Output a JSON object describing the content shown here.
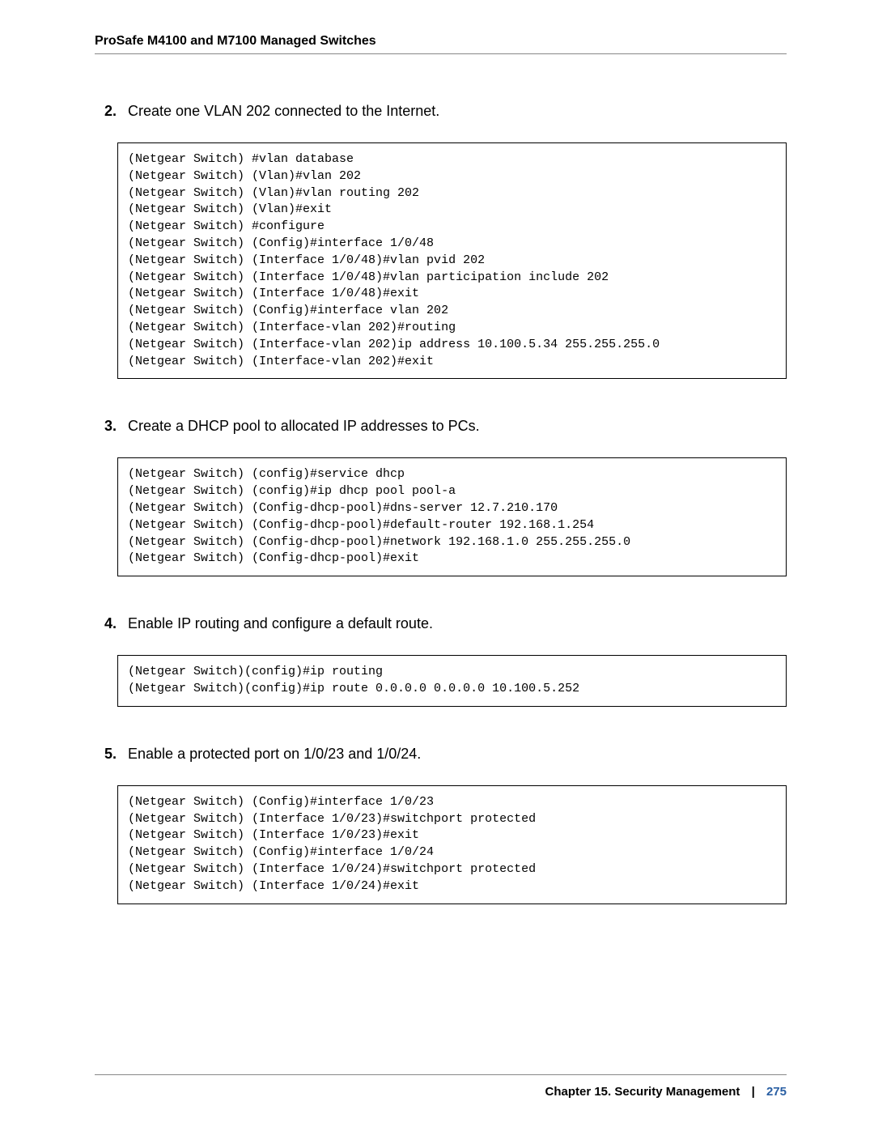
{
  "header": {
    "title": "ProSafe M4100 and M7100 Managed Switches"
  },
  "steps": [
    {
      "num": "2.",
      "text": "Create one VLAN 202 connected to the Internet.",
      "code": "(Netgear Switch) #vlan database\n(Netgear Switch) (Vlan)#vlan 202\n(Netgear Switch) (Vlan)#vlan routing 202\n(Netgear Switch) (Vlan)#exit\n(Netgear Switch) #configure\n(Netgear Switch) (Config)#interface 1/0/48\n(Netgear Switch) (Interface 1/0/48)#vlan pvid 202\n(Netgear Switch) (Interface 1/0/48)#vlan participation include 202\n(Netgear Switch) (Interface 1/0/48)#exit\n(Netgear Switch) (Config)#interface vlan 202\n(Netgear Switch) (Interface-vlan 202)#routing\n(Netgear Switch) (Interface-vlan 202)ip address 10.100.5.34 255.255.255.0\n(Netgear Switch) (Interface-vlan 202)#exit"
    },
    {
      "num": "3.",
      "text": "Create a DHCP pool to allocated IP addresses to PCs.",
      "code": "(Netgear Switch) (config)#service dhcp\n(Netgear Switch) (config)#ip dhcp pool pool-a\n(Netgear Switch) (Config-dhcp-pool)#dns-server 12.7.210.170\n(Netgear Switch) (Config-dhcp-pool)#default-router 192.168.1.254\n(Netgear Switch) (Config-dhcp-pool)#network 192.168.1.0 255.255.255.0\n(Netgear Switch) (Config-dhcp-pool)#exit"
    },
    {
      "num": "4.",
      "text": "Enable IP routing and configure a default route.",
      "code": "(Netgear Switch)(config)#ip routing\n(Netgear Switch)(config)#ip route 0.0.0.0 0.0.0.0 10.100.5.252"
    },
    {
      "num": "5.",
      "text": "Enable a protected port on 1/0/23 and 1/0/24.",
      "code": "(Netgear Switch) (Config)#interface 1/0/23\n(Netgear Switch) (Interface 1/0/23)#switchport protected\n(Netgear Switch) (Interface 1/0/23)#exit\n(Netgear Switch) (Config)#interface 1/0/24\n(Netgear Switch) (Interface 1/0/24)#switchport protected\n(Netgear Switch) (Interface 1/0/24)#exit"
    }
  ],
  "footer": {
    "chapter": "Chapter 15.  Security Management",
    "page": "275"
  }
}
